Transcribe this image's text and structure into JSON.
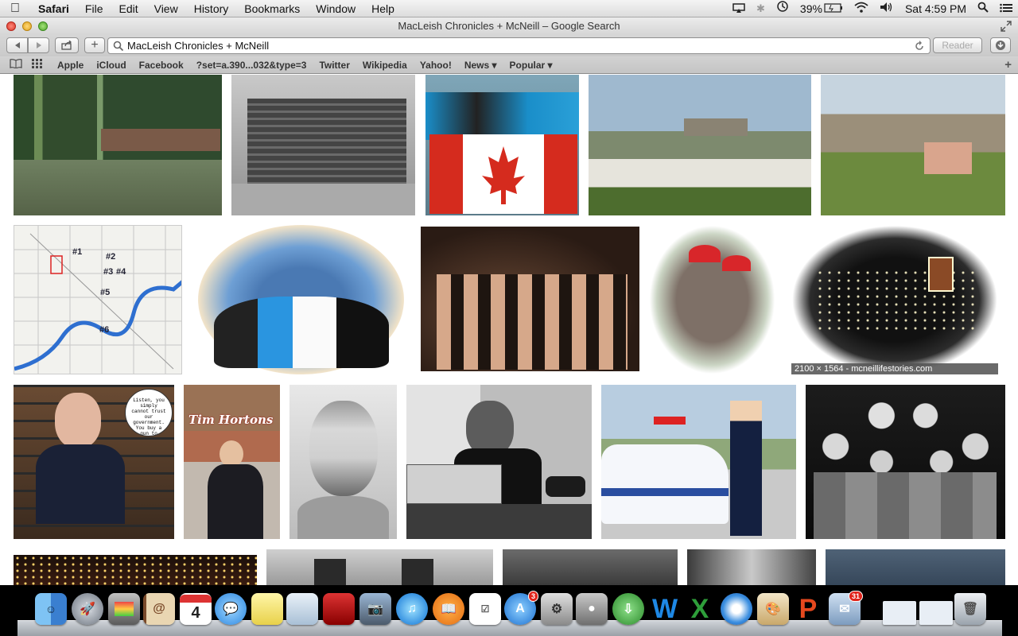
{
  "menubar": {
    "apple": "",
    "items": [
      "Safari",
      "File",
      "Edit",
      "View",
      "History",
      "Bookmarks",
      "Window",
      "Help"
    ],
    "battery": "39%",
    "clock": "Sat 4:59 PM"
  },
  "window": {
    "title": "MacLeish Chronicles + McNeill – Google Search"
  },
  "toolbar": {
    "address_value": "MacLeish Chronicles + McNeill",
    "reader_label": "Reader",
    "add_label": "+"
  },
  "bookmarks": [
    "Apple",
    "iCloud",
    "Facebook",
    "?set=a.390...032&type=3",
    "Twitter",
    "Wikipedia",
    "Yahoo!",
    "News ▾",
    "Popular ▾"
  ],
  "results": {
    "hover_caption": "2100 × 1564 - mcneillifestories.com",
    "map_labels": [
      "#1",
      "#2",
      "#3",
      "#4",
      "#5",
      "#6"
    ],
    "speech_text": "Listen, you simply cannot trust our government. You buy a gun to defend youself when the time comes.",
    "sign_text": "Tim Hortons"
  },
  "dock": {
    "calendar_day": "4",
    "appstore_badge": "3",
    "mail_badge": "31"
  }
}
